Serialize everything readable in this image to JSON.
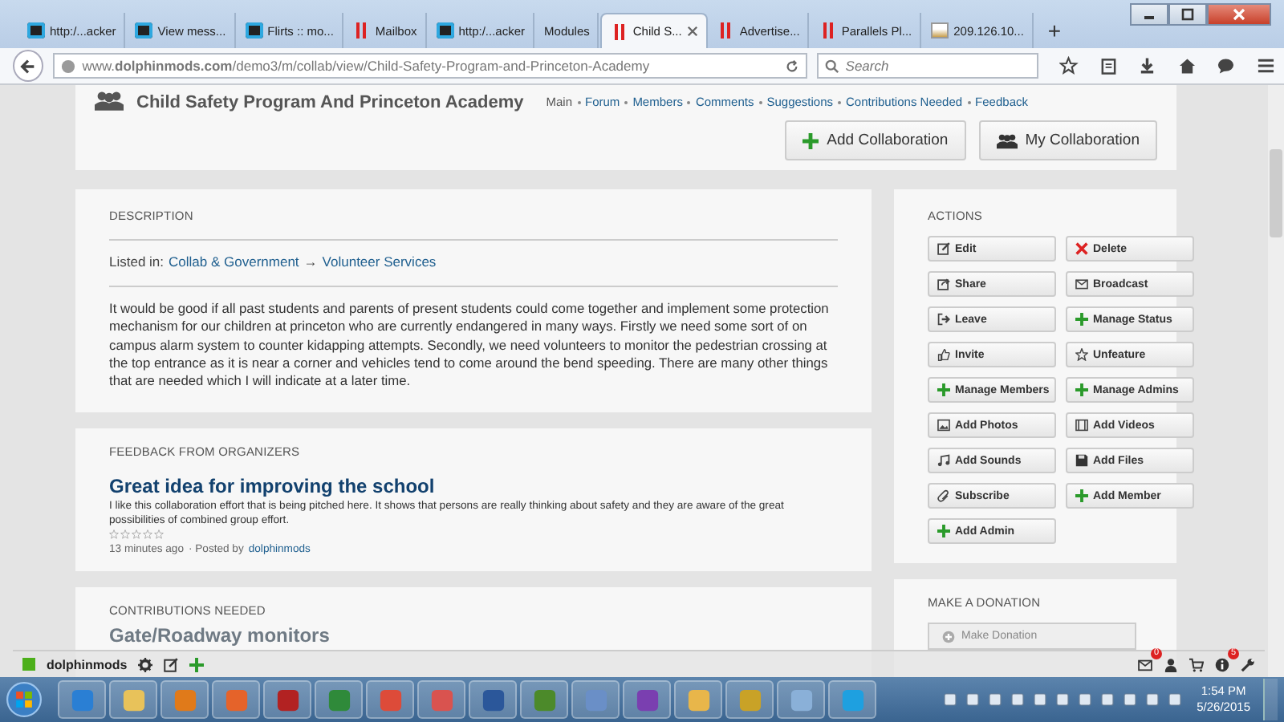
{
  "browser": {
    "tabs": [
      {
        "title": "http:/...acker",
        "kind": "loop",
        "selected": false
      },
      {
        "title": "View mess...",
        "kind": "loop",
        "selected": false
      },
      {
        "title": "Flirts :: mo...",
        "kind": "loop",
        "selected": false
      },
      {
        "title": "Mailbox",
        "kind": "bars",
        "selected": false
      },
      {
        "title": "http:/...acker",
        "kind": "loop",
        "selected": false
      },
      {
        "title": "Modules",
        "kind": "none",
        "selected": false
      },
      {
        "title": "Child S...",
        "kind": "bars",
        "selected": true
      },
      {
        "title": "Advertise...",
        "kind": "bars",
        "selected": false
      },
      {
        "title": "Parallels Pl...",
        "kind": "bars",
        "selected": false
      },
      {
        "title": "209.126.10...",
        "kind": "picture",
        "selected": false
      }
    ],
    "new_tab": "+",
    "url": "www.**dolphinmods.com**/demo3/m/collab/view/Child-Safety-Program-and-Princeton-Academy",
    "search": {
      "placeholder": "Search"
    }
  },
  "header": {
    "title": "Child Safety Program And Princeton Academy",
    "links": [
      {
        "label": "Main",
        "selected": true
      },
      {
        "label": "Forum",
        "selected": false
      },
      {
        "label": "Members",
        "selected": false
      },
      {
        "label": "Comments",
        "selected": false
      },
      {
        "label": "Suggestions",
        "selected": false
      },
      {
        "label": "Contributions Needed",
        "selected": false
      },
      {
        "label": "Feedback",
        "selected": false
      }
    ],
    "buttons": [
      {
        "label": "Add Collaboration",
        "kind": "plus"
      },
      {
        "label": "My Collaboration",
        "kind": "people"
      }
    ]
  },
  "description": {
    "heading": "DESCRIPTION",
    "listed_label": "Listed in:",
    "category": "Collab & Government",
    "arrow": "→",
    "subcategory": "Volunteer Services",
    "text": "It would be good if all past students and parents of present students could come together and implement some protection mechanism for our children at princeton who are currently endangered in many ways. Firstly we need some sort of on campus alarm system to counter kidapping attempts. Secondly, we need volunteers to monitor the pedestrian crossing at the top entrance as it is near a corner and vehicles tend to come around the bend speeding. There are many other things that are needed which I will indicate at a later time."
  },
  "feedback": {
    "heading": "FEEDBACK FROM ORGANIZERS",
    "title": "Great idea for improving the school",
    "text": "I like this collaboration effort that is being pitched here. It shows that persons are really thinking about safety and they are aware of the great possibilities of combined group effort.",
    "stars": 0,
    "time": "13 minutes ago",
    "posted_by": "· Posted by",
    "author": "dolphinmods"
  },
  "contributions": {
    "heading": "CONTRIBUTIONS NEEDED",
    "item_title": "Gate/Roadway monitors"
  },
  "actions": {
    "heading": "ACTIONS",
    "buttons": [
      {
        "label": "Edit",
        "kind": "edit"
      },
      {
        "label": "Delete",
        "kind": "delete"
      },
      {
        "label": "Share",
        "kind": "share"
      },
      {
        "label": "Broadcast",
        "kind": "mail"
      },
      {
        "label": "Leave",
        "kind": "leave"
      },
      {
        "label": "Manage Status",
        "kind": "plus"
      },
      {
        "label": "Invite",
        "kind": "thumb"
      },
      {
        "label": "Unfeature",
        "kind": "star"
      },
      {
        "label": "Manage Members",
        "kind": "plus"
      },
      {
        "label": "Manage Admins",
        "kind": "plus"
      },
      {
        "label": "Add Photos",
        "kind": "photo"
      },
      {
        "label": "Add Videos",
        "kind": "film"
      },
      {
        "label": "Add Sounds",
        "kind": "music"
      },
      {
        "label": "Add Files",
        "kind": "file"
      },
      {
        "label": "Subscribe",
        "kind": "clip"
      },
      {
        "label": "Add Member",
        "kind": "plus"
      },
      {
        "label": "Add Admin",
        "kind": "plus"
      }
    ]
  },
  "donation": {
    "heading": "MAKE A DONATION",
    "button": "Make Donation",
    "disabled": true
  },
  "toolbar": {
    "user": "dolphinmods",
    "mail_badge": "0",
    "info_badge": "5"
  },
  "taskbar": {
    "time": "1:54 PM",
    "date": "5/26/2015"
  }
}
